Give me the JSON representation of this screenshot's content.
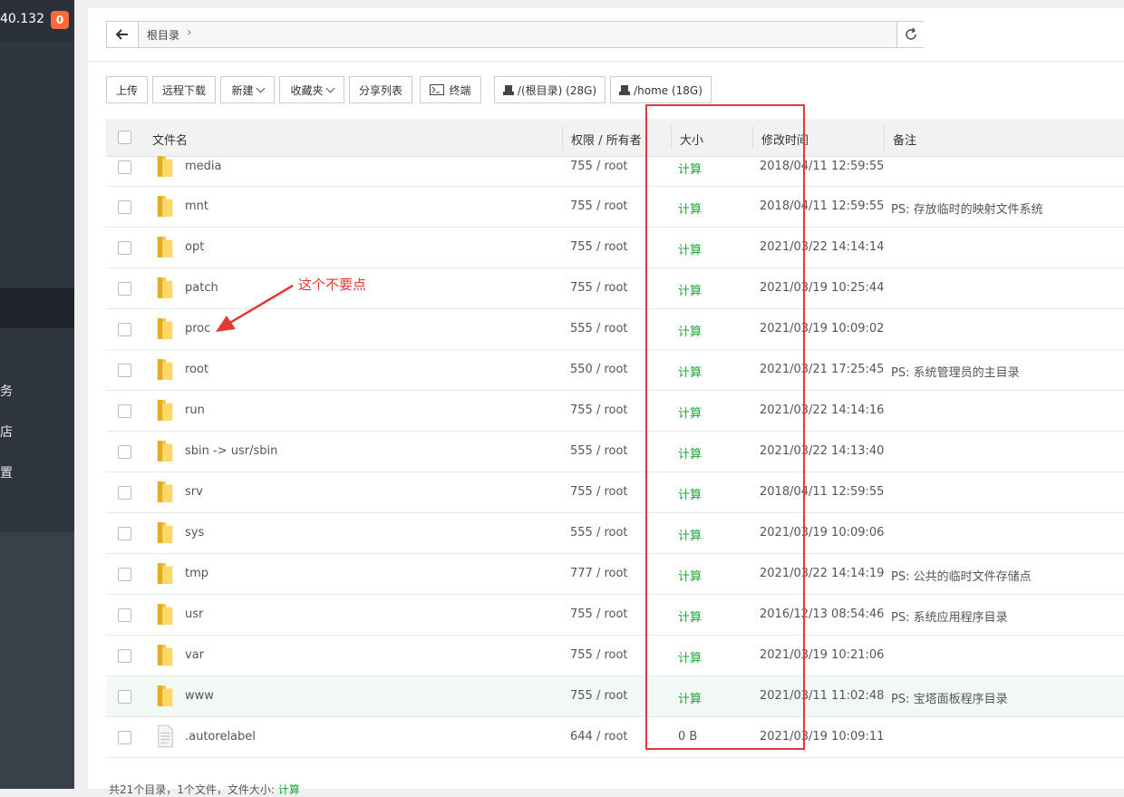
{
  "sidebar": {
    "ip_suffix": "40.132",
    "badge_count": "0",
    "items": [
      "务",
      "店",
      "置"
    ],
    "stray": "·"
  },
  "pathbar": {
    "crumb": "根目录",
    "separator": "›"
  },
  "toolbar": {
    "upload": "上传",
    "remote_download": "远程下载",
    "new": "新建",
    "favorites": "收藏夹",
    "share_list": "分享列表",
    "terminal": "终端",
    "disk_root": "/(根目录) (28G)",
    "disk_home": "/home (18G)"
  },
  "table": {
    "headers": {
      "name": "文件名",
      "perm": "权限 / 所有者",
      "size": "大小",
      "mtime": "修改时间",
      "note": "备注"
    },
    "rows": [
      {
        "name": "media",
        "perm": "755 / root",
        "size": "计算",
        "mtime": "2018/04/11 12:59:55",
        "note": "",
        "type": "folder"
      },
      {
        "name": "mnt",
        "perm": "755 / root",
        "size": "计算",
        "mtime": "2018/04/11 12:59:55",
        "note": "PS: 存放临时的映射文件系统",
        "type": "folder"
      },
      {
        "name": "opt",
        "perm": "755 / root",
        "size": "计算",
        "mtime": "2021/03/22 14:14:14",
        "note": "",
        "type": "folder"
      },
      {
        "name": "patch",
        "perm": "755 / root",
        "size": "计算",
        "mtime": "2021/03/19 10:25:44",
        "note": "",
        "type": "folder"
      },
      {
        "name": "proc",
        "perm": "555 / root",
        "size": "计算",
        "mtime": "2021/03/19 10:09:02",
        "note": "",
        "type": "folder"
      },
      {
        "name": "root",
        "perm": "550 / root",
        "size": "计算",
        "mtime": "2021/03/21 17:25:45",
        "note": "PS: 系统管理员的主目录",
        "type": "folder"
      },
      {
        "name": "run",
        "perm": "755 / root",
        "size": "计算",
        "mtime": "2021/03/22 14:14:16",
        "note": "",
        "type": "folder"
      },
      {
        "name": "sbin -> usr/sbin",
        "perm": "555 / root",
        "size": "计算",
        "mtime": "2021/03/22 14:13:40",
        "note": "",
        "type": "folder"
      },
      {
        "name": "srv",
        "perm": "755 / root",
        "size": "计算",
        "mtime": "2018/04/11 12:59:55",
        "note": "",
        "type": "folder"
      },
      {
        "name": "sys",
        "perm": "555 / root",
        "size": "计算",
        "mtime": "2021/03/19 10:09:06",
        "note": "",
        "type": "folder"
      },
      {
        "name": "tmp",
        "perm": "777 / root",
        "size": "计算",
        "mtime": "2021/03/22 14:14:19",
        "note": "PS: 公共的临时文件存储点",
        "type": "folder"
      },
      {
        "name": "usr",
        "perm": "755 / root",
        "size": "计算",
        "mtime": "2016/12/13 08:54:46",
        "note": "PS: 系统应用程序目录",
        "type": "folder"
      },
      {
        "name": "var",
        "perm": "755 / root",
        "size": "计算",
        "mtime": "2021/03/19 10:21:06",
        "note": "",
        "type": "folder"
      },
      {
        "name": "www",
        "perm": "755 / root",
        "size": "计算",
        "mtime": "2021/03/11 11:02:48",
        "note": "PS: 宝塔面板程序目录",
        "type": "folder"
      },
      {
        "name": ".autorelabel",
        "perm": "644 / root",
        "size": "0 B",
        "mtime": "2021/03/19 10:09:11",
        "note": "",
        "type": "file"
      }
    ]
  },
  "footer": {
    "summary": "共21个目录，1个文件，文件大小:",
    "calc_link": "计算"
  },
  "annotation": {
    "text": "这个不要点"
  },
  "colors": {
    "accent_green": "#20a53a",
    "annotation_red": "#e53935",
    "sidebar_bg": "#2f3640",
    "badge": "#ff6b35"
  }
}
